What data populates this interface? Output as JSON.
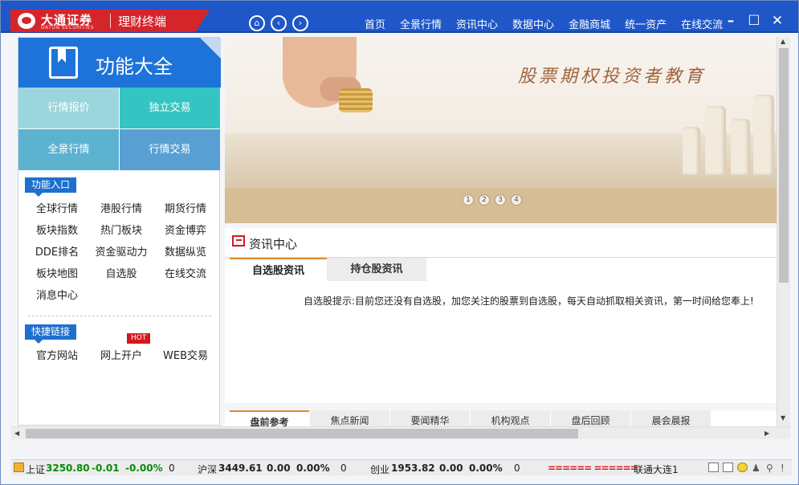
{
  "app": {
    "brand_cn": "大通证券",
    "brand_en": "DATON SECURITIES",
    "product": "理财终端"
  },
  "toolbar": {
    "home_icon": "home-icon",
    "back_icon": "back-arrow-icon",
    "forward_icon": "forward-arrow-icon",
    "nav": [
      "首页",
      "全景行情",
      "资讯中心",
      "数据中心",
      "金融商城",
      "统一资产",
      "在线交流"
    ],
    "window_controls": [
      "minimize-icon",
      "maximize-icon",
      "close-icon"
    ]
  },
  "sidebar": {
    "title": "功能大全",
    "tiles": [
      {
        "label": "行情报价",
        "color": "#9bd6dc"
      },
      {
        "label": "独立交易",
        "color": "#34c5c2"
      },
      {
        "label": "全景行情",
        "color": "#5db2d0"
      },
      {
        "label": "行情交易",
        "color": "#5a9fd3"
      }
    ],
    "function_section": {
      "label": "功能入口",
      "items": [
        "全球行情",
        "港股行情",
        "期货行情",
        "板块指数",
        "热门板块",
        "资金博弈",
        "DDE排名",
        "资金驱动力",
        "数据纵览",
        "板块地图",
        "自选股",
        "在线交流",
        "消息中心"
      ]
    },
    "quick_section": {
      "label": "快捷链接",
      "items": [
        "官方网站",
        "网上开户",
        "WEB交易"
      ],
      "hot_badge": "HOT"
    }
  },
  "banner": {
    "text": "股票期权投资者教育",
    "dots": [
      "1",
      "2",
      "3",
      "4"
    ]
  },
  "news": {
    "title": "资讯中心",
    "tabs": [
      "自选股资讯",
      "持仓股资讯"
    ],
    "message": "自选股提示:目前您还没有自选股，加您关注的股票到自选股，每天自动抓取相关资讯，第一时间给您奉上!"
  },
  "bottom_tabs": [
    "盘前参考",
    "焦点新闻",
    "要闻精华",
    "机构观点",
    "盘后回顾",
    "晨会晨报"
  ],
  "status": {
    "sh_label": "上证",
    "sh_value": "3250.80",
    "sh_change": "-0.01",
    "sh_pct": "-0.00%",
    "sh_vol": "0",
    "sz_label": "沪深",
    "sz_value": "3449.61",
    "sz_change": "0.00",
    "sz_pct": "0.00%",
    "sz_vol": "0",
    "cy_label": "创业",
    "cy_value": "1953.82",
    "cy_change": "0.00",
    "cy_pct": "0.00%",
    "cy_vol": "0",
    "ticker": "====== ======",
    "server": "联通大连1",
    "tray_icons": [
      "window-icon",
      "window-icon",
      "smiley-icon",
      "person-icon",
      "tree-icon",
      "exclamation-icon"
    ]
  }
}
